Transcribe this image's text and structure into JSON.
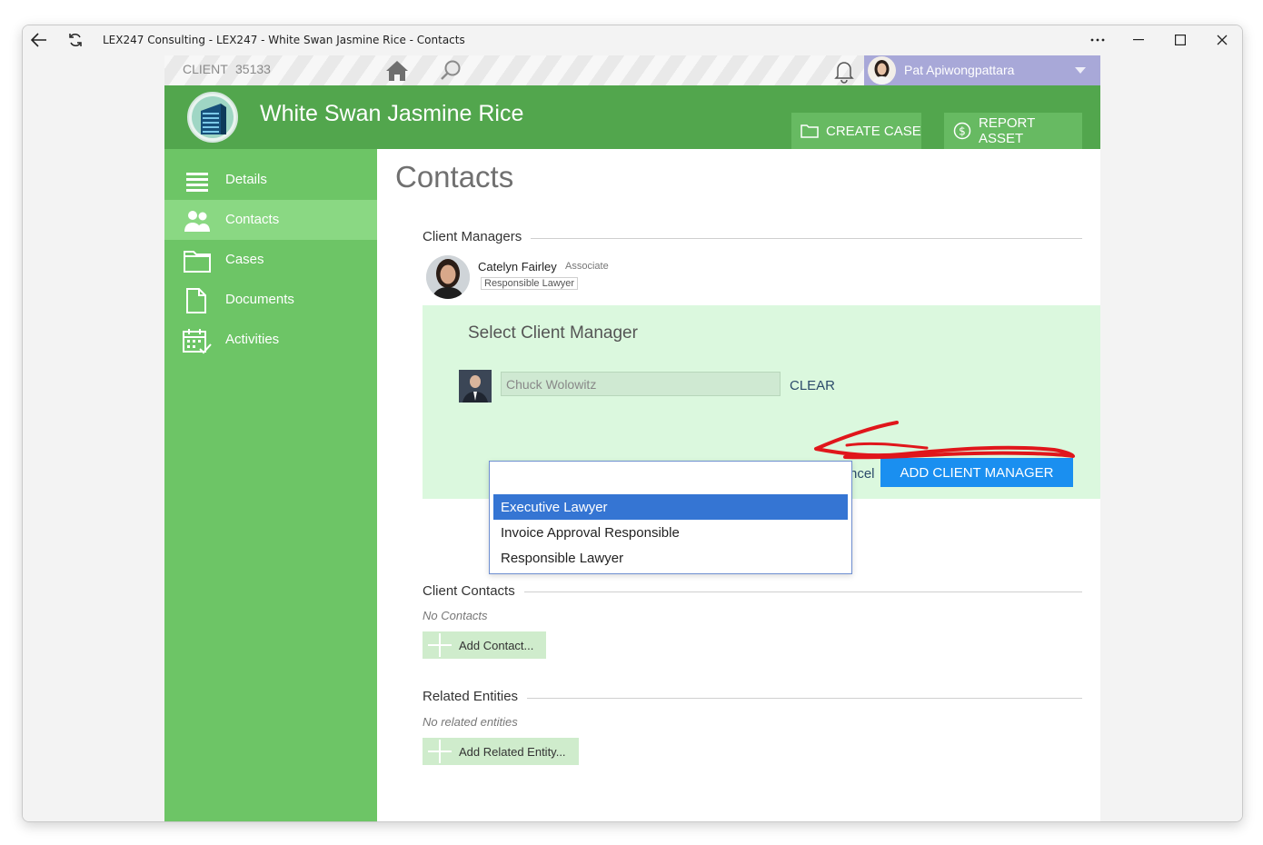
{
  "window": {
    "title": "LEX247 Consulting - LEX247 - White Swan Jasmine Rice - Contacts"
  },
  "topbar": {
    "client_label": "CLIENT",
    "client_number": "35133",
    "user_name": "Pat Apiwongpattara"
  },
  "header": {
    "client_title": "White Swan Jasmine Rice",
    "create_case_label": "CREATE CASE",
    "report_asset_label": "REPORT ASSET"
  },
  "sidebar": {
    "items": [
      {
        "label": "Details"
      },
      {
        "label": "Contacts"
      },
      {
        "label": "Cases"
      },
      {
        "label": "Documents"
      },
      {
        "label": "Activities"
      }
    ]
  },
  "main": {
    "page_title": "Contacts",
    "client_managers": {
      "title": "Client Managers",
      "manager": {
        "name": "Catelyn Fairley",
        "position": "Associate",
        "role": "Responsible Lawyer"
      }
    },
    "select_manager": {
      "title": "Select Client Manager",
      "candidate_value": "Chuck Wolowitz",
      "clear_label": "CLEAR",
      "cancel_label": "ncel",
      "add_label": "ADD CLIENT MANAGER",
      "role_options": [
        "Executive Lawyer",
        "Invoice Approval Responsible",
        "Responsible Lawyer"
      ],
      "selected_role": "Executive Lawyer"
    },
    "client_contacts": {
      "title": "Client Contacts",
      "empty_text": "No Contacts",
      "add_label": "Add Contact..."
    },
    "related_entities": {
      "title": "Related Entities",
      "empty_text": "No related entities",
      "add_label": "Add Related Entity..."
    }
  },
  "colors": {
    "header_green": "#52a64d",
    "sidebar_green": "#6dc566",
    "active_nav": "#8ad883",
    "panel_green": "#dbf8de",
    "primary_blue": "#1a8ff0",
    "selected_option": "#3575d3",
    "annotation_red": "#e0161b"
  }
}
